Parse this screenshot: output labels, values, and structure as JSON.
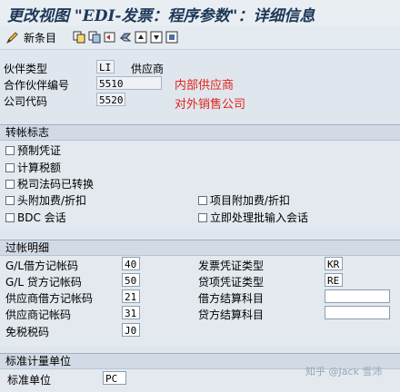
{
  "window": {
    "title": "更改视图 \"EDI-发票：程序参数\"：详细信息"
  },
  "toolbar": {
    "new_entry_label": "新条目"
  },
  "header": {
    "partner_type": {
      "label": "伙伴类型",
      "value": "LI",
      "desc": "供应商"
    },
    "partner_number": {
      "label": "合作伙伴编号",
      "value": "5510",
      "note": "内部供应商"
    },
    "company_code": {
      "label": "公司代码",
      "value": "5520",
      "note": "对外销售公司"
    }
  },
  "posting": {
    "title": "转帐标志",
    "checkboxes": [
      {
        "label": "预制凭证",
        "checked": false
      },
      {
        "label": "计算税额",
        "checked": false
      },
      {
        "label": "税司法码已转换",
        "checked": false
      },
      {
        "label": "头附加费/折扣",
        "checked": false
      },
      {
        "label": "项目附加费/折扣",
        "checked": false
      },
      {
        "label": "BDC 会话",
        "checked": false
      },
      {
        "label": "立即处理批输入会话",
        "checked": false
      }
    ]
  },
  "details": {
    "title": "过帐明细",
    "left": [
      {
        "label": "G/L借方记帐码",
        "value": "40"
      },
      {
        "label": "G/L 贷方记帐码",
        "value": "50"
      },
      {
        "label": "供应商借方记帐码",
        "value": "21"
      },
      {
        "label": "供应商记帐码",
        "value": "31"
      },
      {
        "label": "免税税码",
        "value": "J0"
      }
    ],
    "right": [
      {
        "label": "发票凭证类型",
        "value": "KR"
      },
      {
        "label": "贷项凭证类型",
        "value": "RE"
      },
      {
        "label": "借方结算科目",
        "value": ""
      },
      {
        "label": "贷方结算科目",
        "value": ""
      }
    ]
  },
  "uom": {
    "title": "标准计量单位",
    "field": {
      "label": "标准单位",
      "value": "PC"
    }
  },
  "watermark": "知乎 @Jack 雪沛"
}
